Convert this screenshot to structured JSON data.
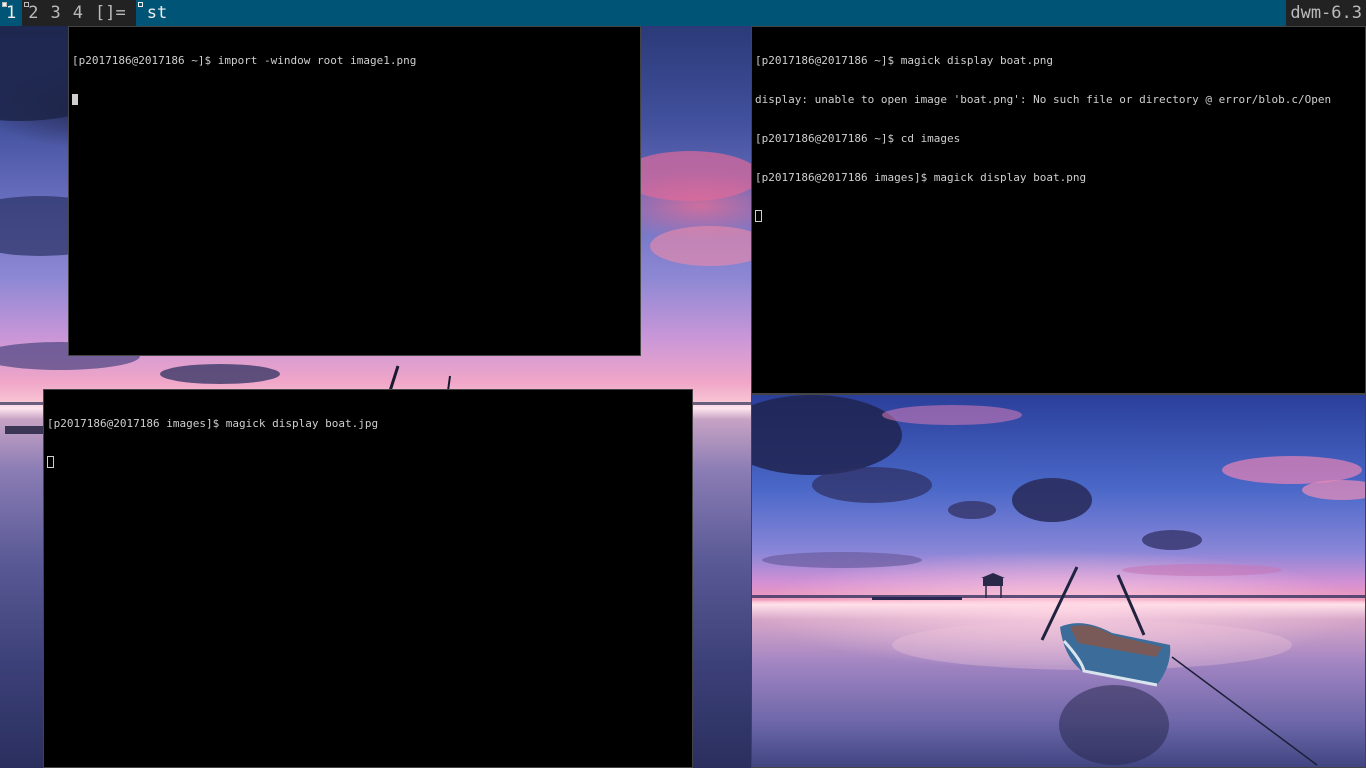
{
  "bar": {
    "tags": [
      {
        "label": "1",
        "selected": true,
        "occupied": true
      },
      {
        "label": "2",
        "selected": false,
        "occupied": true
      },
      {
        "label": "3",
        "selected": false,
        "occupied": false
      },
      {
        "label": "4",
        "selected": false,
        "occupied": false
      }
    ],
    "layout_symbol": "[]=",
    "window_title": "st",
    "status_text": "dwm-6.3",
    "colors": {
      "selected_bg": "#005577",
      "normal_bg": "#222222",
      "normal_fg": "#bbbbbb",
      "selected_fg": "#eeeeee"
    }
  },
  "terminals": {
    "top_left": {
      "lines": [
        "[p2017186@2017186 ~]$ import -window root image1.png"
      ]
    },
    "bottom_left": {
      "lines": [
        "[p2017186@2017186 images]$ magick display boat.jpg"
      ]
    },
    "right": {
      "lines": [
        "[p2017186@2017186 ~]$ magick display boat.png",
        "display: unable to open image 'boat.png': No such file or directory @ error/blob.c/Open",
        "[p2017186@2017186 ~]$ cd images",
        "[p2017186@2017186 images]$ magick display boat.png"
      ]
    }
  },
  "viewer": {
    "content": "sunset-boat-photo"
  }
}
